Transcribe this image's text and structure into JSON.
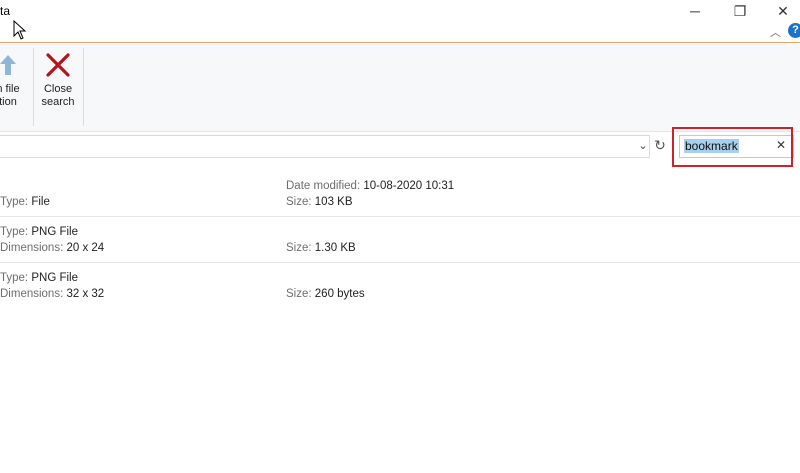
{
  "window": {
    "title_fragment": "ta",
    "controls": {
      "minimize": "─",
      "maximize": "❐",
      "close": "✕"
    }
  },
  "ribbon": {
    "open_file_location_line1": "n file",
    "open_file_location_line2": "tion",
    "close_search_line1": "Close",
    "close_search_line2": "search"
  },
  "address_bar": {
    "value": ""
  },
  "search": {
    "value": "bookmark",
    "clear_glyph": "✕"
  },
  "results": [
    {
      "type_label": "Type:",
      "type_value": "File",
      "date_label": "Date modified:",
      "date_value": "10-08-2020 10:31",
      "size_label": "Size:",
      "size_value": "103 KB"
    },
    {
      "type_label": "Type:",
      "type_value": "PNG File",
      "dim_label": "Dimensions:",
      "dim_value": "20 x 24",
      "size_label": "Size:",
      "size_value": "1.30 KB"
    },
    {
      "type_label": "Type:",
      "type_value": "PNG File",
      "dim_label": "Dimensions:",
      "dim_value": "32 x 32",
      "size_label": "Size:",
      "size_value": "260 bytes"
    }
  ],
  "colors": {
    "accent_border": "#e3a865",
    "highlight_box": "#d0202a",
    "close_search_x": "#b5121b",
    "help": "#1a73c9",
    "selection": "#a9cfee"
  }
}
